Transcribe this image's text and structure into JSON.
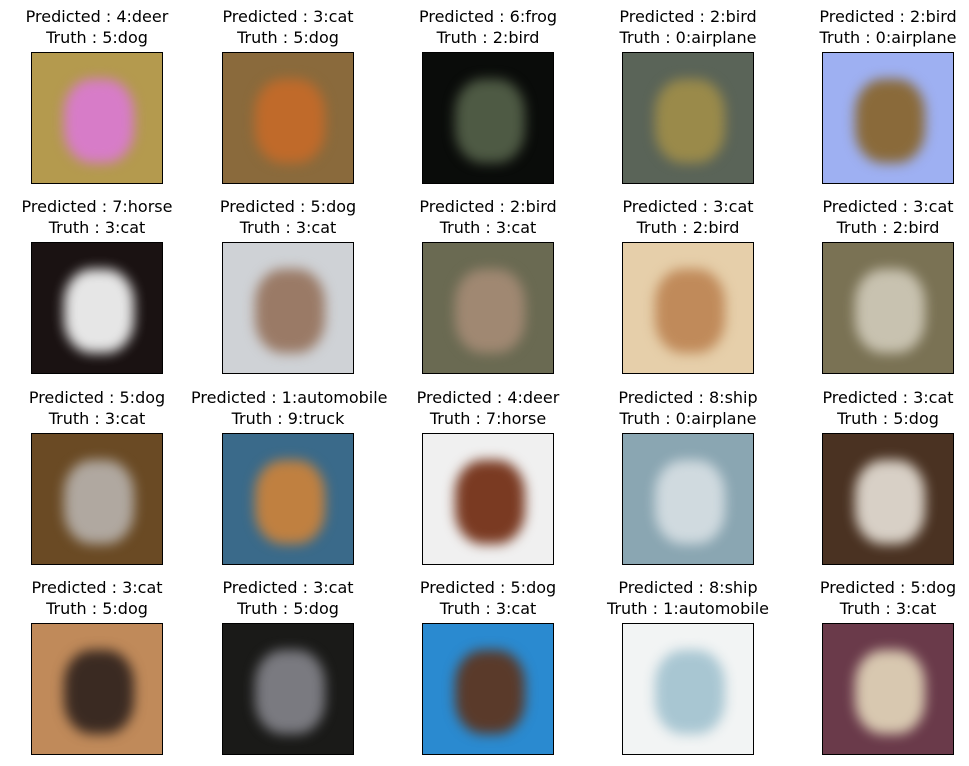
{
  "cells": [
    {
      "pred": "Predicted : 4:deer",
      "truth": "Truth : 5:dog",
      "bg": "#b49a4e",
      "fg": "#d77cc8"
    },
    {
      "pred": "Predicted : 3:cat",
      "truth": "Truth : 5:dog",
      "bg": "#8a6a3c",
      "fg": "#c06a2a"
    },
    {
      "pred": "Predicted : 6:frog",
      "truth": "Truth : 2:bird",
      "bg": "#0a0c0a",
      "fg": "#4e5a44"
    },
    {
      "pred": "Predicted : 2:bird",
      "truth": "Truth : 0:airplane",
      "bg": "#5a6458",
      "fg": "#9a8a4a"
    },
    {
      "pred": "Predicted : 2:bird",
      "truth": "Truth : 0:airplane",
      "bg": "#9eb0f2",
      "fg": "#8a6a3a"
    },
    {
      "pred": "Predicted : 7:horse",
      "truth": "Truth : 3:cat",
      "bg": "#1a1212",
      "fg": "#e6e6e6"
    },
    {
      "pred": "Predicted : 5:dog",
      "truth": "Truth : 3:cat",
      "bg": "#cfd2d6",
      "fg": "#9a7a66"
    },
    {
      "pred": "Predicted : 2:bird",
      "truth": "Truth : 3:cat",
      "bg": "#6a6a52",
      "fg": "#a08872"
    },
    {
      "pred": "Predicted : 3:cat",
      "truth": "Truth : 2:bird",
      "bg": "#e6cfaa",
      "fg": "#c08a5a"
    },
    {
      "pred": "Predicted : 3:cat",
      "truth": "Truth : 2:bird",
      "bg": "#7a7254",
      "fg": "#c8c2b0"
    },
    {
      "pred": "Predicted : 5:dog",
      "truth": "Truth : 3:cat",
      "bg": "#6a4a24",
      "fg": "#b0a8a0"
    },
    {
      "pred": "Predicted : 1:automobile",
      "truth": "Truth : 9:truck",
      "bg": "#3a6a8a",
      "fg": "#c08040"
    },
    {
      "pred": "Predicted : 4:deer",
      "truth": "Truth : 7:horse",
      "bg": "#f0f0f0",
      "fg": "#7a3a22"
    },
    {
      "pred": "Predicted : 8:ship",
      "truth": "Truth : 0:airplane",
      "bg": "#8aa6b2",
      "fg": "#d0dadf"
    },
    {
      "pred": "Predicted : 3:cat",
      "truth": "Truth : 5:dog",
      "bg": "#4a3222",
      "fg": "#d8d0c6"
    },
    {
      "pred": "Predicted : 3:cat",
      "truth": "Truth : 5:dog",
      "bg": "#c08a5a",
      "fg": "#3a2a22"
    },
    {
      "pred": "Predicted : 3:cat",
      "truth": "Truth : 5:dog",
      "bg": "#1a1a18",
      "fg": "#7a7a80"
    },
    {
      "pred": "Predicted : 5:dog",
      "truth": "Truth : 3:cat",
      "bg": "#2a8ad0",
      "fg": "#5a3a2a"
    },
    {
      "pred": "Predicted : 8:ship",
      "truth": "Truth : 1:automobile",
      "bg": "#f2f4f4",
      "fg": "#a8c6d2"
    },
    {
      "pred": "Predicted : 5:dog",
      "truth": "Truth : 3:cat",
      "bg": "#6a3a4a",
      "fg": "#d8c8b0"
    }
  ]
}
